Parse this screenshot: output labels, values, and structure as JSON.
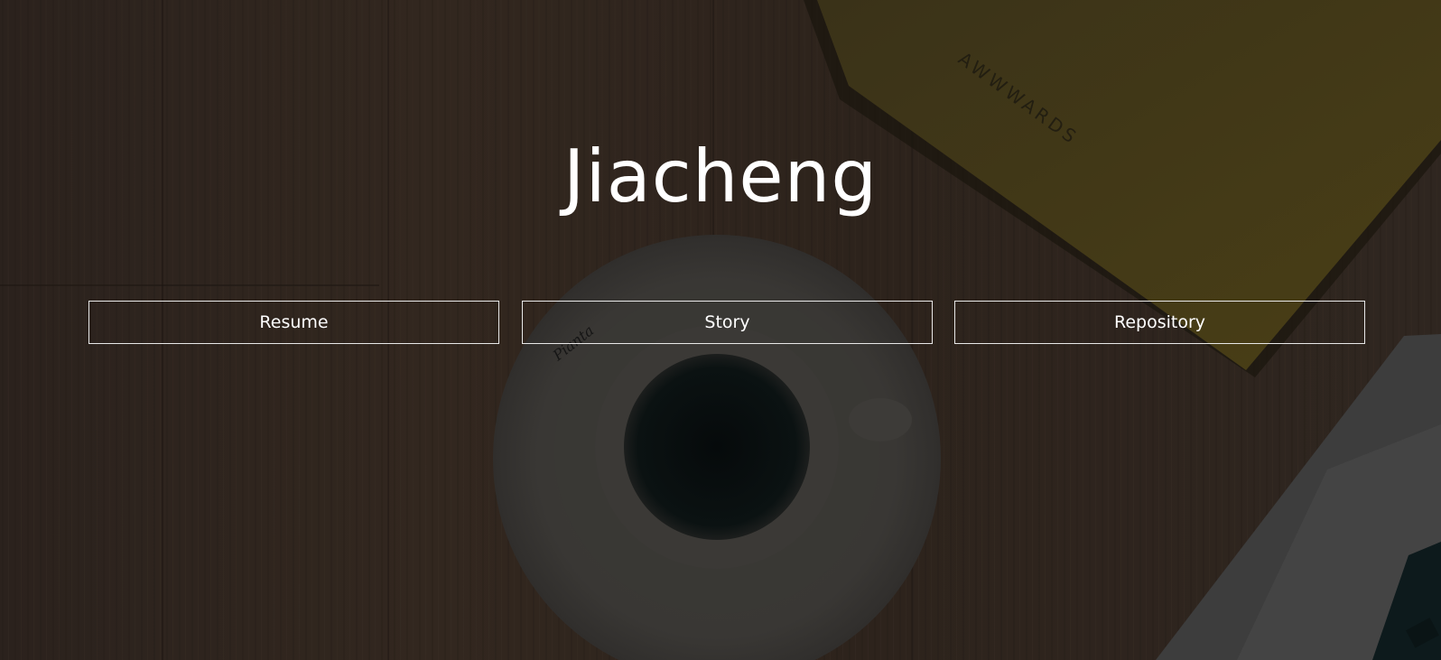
{
  "site": {
    "title": "Jiacheng"
  },
  "nav": {
    "items": [
      {
        "label": "Resume"
      },
      {
        "label": "Story"
      },
      {
        "label": "Repository"
      }
    ]
  },
  "background": {
    "notebook_text": "AWWWARDS",
    "cup_text": "Pianta",
    "colors": {
      "wood": "#2e241e",
      "notebook": "#3f3618",
      "saucer": "#3a3836",
      "coffee": "#040809",
      "laptop": "#3b3b3b"
    }
  }
}
